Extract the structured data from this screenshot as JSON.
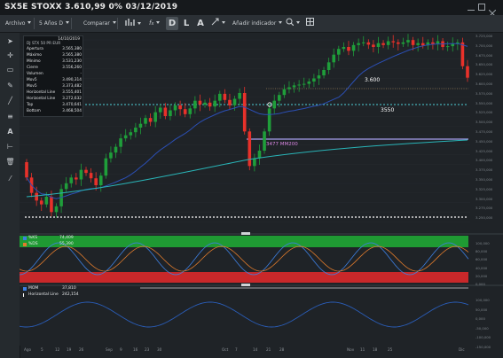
{
  "window": {
    "title": "SX5E STOXX 3.610,99 0% 03/12/2019"
  },
  "toolbar": {
    "archivo": "Archivo",
    "period": "5 Años D",
    "comparar": "Comparar",
    "chart_type_icon": "bar-chart-icon",
    "indicators_icon": "function-icon",
    "d_label": "D",
    "l_label": "L",
    "a_label": "A",
    "add_indicator": "Añadir indicador",
    "search_icon": "zoom-icon"
  },
  "info_panel": {
    "date": "14/10/2019",
    "symbol": "DJ STX 50 PR EUR",
    "rows": [
      {
        "label": "Apertura",
        "value": "3.565,380"
      },
      {
        "label": "Máximo",
        "value": "3.565,380"
      },
      {
        "label": "Mínimo",
        "value": "3.531,230"
      },
      {
        "label": "Cierre",
        "value": "3.556,260"
      },
      {
        "label": "Volumen",
        "value": "-"
      },
      {
        "label": "Mov5",
        "value": "3.490,314"
      },
      {
        "label": "Mov5",
        "value": "3.373,482"
      },
      {
        "label": "Horizontal Line",
        "value": "3.555,401"
      },
      {
        "label": "Horizontal Line",
        "value": "3.272,632"
      },
      {
        "label": "Top",
        "value": "3.470,641"
      },
      {
        "label": "Bottom",
        "value": "3.468,504"
      }
    ]
  },
  "annotations": {
    "level_3600": "3.600",
    "level_3550": "3550",
    "mm200": "3477 MM200"
  },
  "colors": {
    "up": "#1f9e3a",
    "down": "#e8312a",
    "ma_fast": "#2b4fb5",
    "ma_slow": "#29b5b8",
    "mm200_line": "#a7a0f0"
  },
  "price_axis": [
    "3.725,000",
    "3.700,000",
    "3.675,000",
    "3.650,000",
    "3.625,000",
    "3.600,000",
    "3.575,000",
    "3.550,000",
    "3.525,000",
    "3.500,000",
    "3.475,000",
    "3.450,000",
    "3.425,000",
    "3.400,000",
    "3.375,000",
    "3.350,000",
    "3.325,000",
    "3.300,000",
    "3.275,000",
    "3.250,000"
  ],
  "stoch": {
    "rows": [
      {
        "label": "%KS",
        "value": "74,409"
      },
      {
        "label": "%DS",
        "value": "55,390"
      }
    ],
    "axis": [
      "100,000",
      "80,000",
      "60,000",
      "40,000",
      "20,000",
      "0,000"
    ]
  },
  "mom": {
    "rows": [
      {
        "label": "MOM",
        "value": "37,810"
      },
      {
        "label": "Horizontal Line",
        "value": "242,154"
      }
    ],
    "axis": [
      "100,000",
      "50,000",
      "0,000",
      "-50,000",
      "-100,000",
      "-150,000"
    ]
  },
  "x_axis": [
    "Ago",
    "5",
    "12",
    "19",
    "26",
    "Sep",
    "9",
    "16",
    "23",
    "30",
    "Oct",
    "7",
    "14",
    "21",
    "28",
    "Nov",
    "11",
    "18",
    "25",
    "Dic"
  ]
}
